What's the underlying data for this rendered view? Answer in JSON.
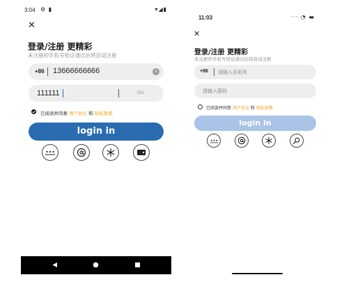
{
  "left": {
    "status": {
      "time": "3:04",
      "icons_left": "⚙ ▮",
      "icons_right": "▾◢▮"
    },
    "title": "登录/注册 更精彩",
    "subtitle": "未注册的手机号验证通过后将自动注册",
    "phone": {
      "prefix": "+86",
      "value": "13666666666"
    },
    "code": {
      "value": "111111",
      "countdown": "38s"
    },
    "agreement": {
      "text1": "已阅读并同意",
      "link1": "用户协议",
      "and": "和",
      "link2": "隐私政策"
    },
    "login_label": "login in",
    "colors": {
      "button": "#2b6cb0",
      "link": "#f5a623"
    }
  },
  "right": {
    "status": {
      "time": "11:03",
      "icons": "··· ◔ ▬"
    },
    "title": "登录/注册 更精彩",
    "subtitle": "未注册的手机号验证通过后将自动注册",
    "phone": {
      "prefix": "+86",
      "placeholder": "请输入手机号"
    },
    "password": {
      "placeholder": "请输入密码"
    },
    "agreement": {
      "text1": "已阅读并同意",
      "link1": "用户协议",
      "and": "和",
      "link2": "隐私政策"
    },
    "login_label": "login in",
    "colors": {
      "button": "#a9c4e6",
      "link": "#f5a623"
    }
  },
  "icons": [
    "sms-login-icon",
    "email-login-icon",
    "snowflake-icon",
    "card-login-icon",
    "key-search-icon"
  ]
}
